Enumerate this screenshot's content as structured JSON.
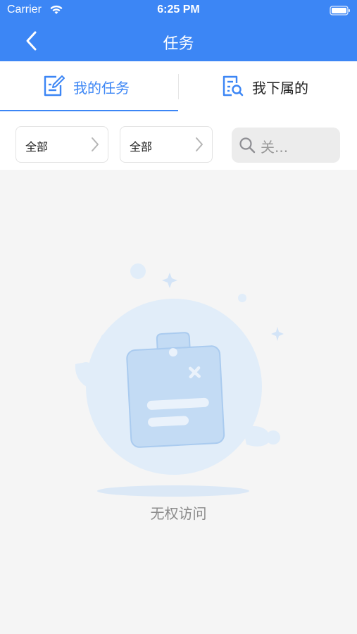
{
  "status_bar": {
    "carrier": "Carrier",
    "time": "6:25 PM"
  },
  "nav": {
    "title": "任务",
    "back_icon": "chevron-left-icon"
  },
  "tabs": [
    {
      "label": "我的任务",
      "icon": "edit-document-icon",
      "active": true
    },
    {
      "label": "我下属的",
      "icon": "document-search-icon",
      "active": false
    }
  ],
  "filters": {
    "select_1": "全部",
    "select_2": "全部",
    "search_placeholder": "关..."
  },
  "empty_state": {
    "message": "无权访问",
    "illustration": "clipboard-no-access-icon"
  },
  "colors": {
    "primary": "#3c86f5",
    "background": "#f5f5f5",
    "illustration": "#c8def6"
  }
}
